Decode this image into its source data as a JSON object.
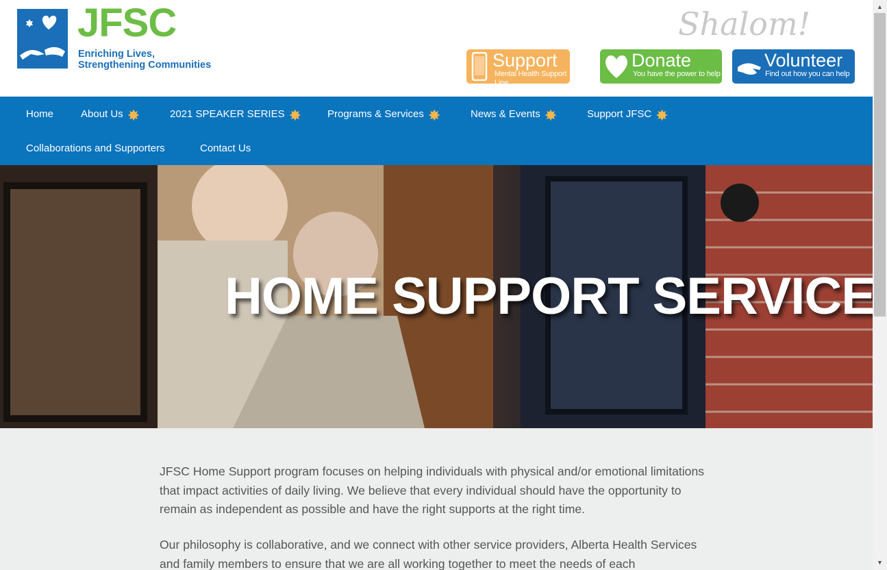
{
  "brand": {
    "name": "JFSC",
    "tagline_line1": "Enriching Lives,",
    "tagline_line2": "Strengthening Communities",
    "greeting": "Shalom!"
  },
  "cta": {
    "support": {
      "title": "Support",
      "subtitle": "Mental Health Support Line",
      "color": "#f6b35d"
    },
    "donate": {
      "title": "Donate",
      "subtitle": "You have the power to help",
      "color": "#6bbd45"
    },
    "volunteer": {
      "title": "Volunteer",
      "subtitle": "Find out how you can help",
      "color": "#1a6fb8"
    }
  },
  "nav": {
    "items": [
      {
        "label": "Home"
      },
      {
        "label": "About Us"
      },
      {
        "label": "2021 SPEAKER SERIES"
      },
      {
        "label": "Programs & Services"
      },
      {
        "label": "News & Events"
      },
      {
        "label": "Support JFSC"
      },
      {
        "label": "Collaborations and Supporters"
      },
      {
        "label": "Contact Us"
      }
    ],
    "background": "#0a74bd",
    "accent": "#f7b74a"
  },
  "hero": {
    "title": "HOME SUPPORT SERVICES"
  },
  "content": {
    "paragraph1": "JFSC Home Support program focuses on helping individuals with physical and/or emotional limitations that impact activities of daily living. We believe that every individual should have the opportunity to remain as independent as possible and have the right supports at the right time.",
    "paragraph2": "Our philosophy is collaborative, and we connect with other service providers, Alberta Health Services and family members to ensure that we are all working together to meet the needs of each"
  },
  "icons": {
    "logo": "star-of-david-heart-hands-icon",
    "support": "phone-icon",
    "donate": "heart-icon",
    "volunteer": "hand-icon",
    "dropdown": "star-icon"
  }
}
